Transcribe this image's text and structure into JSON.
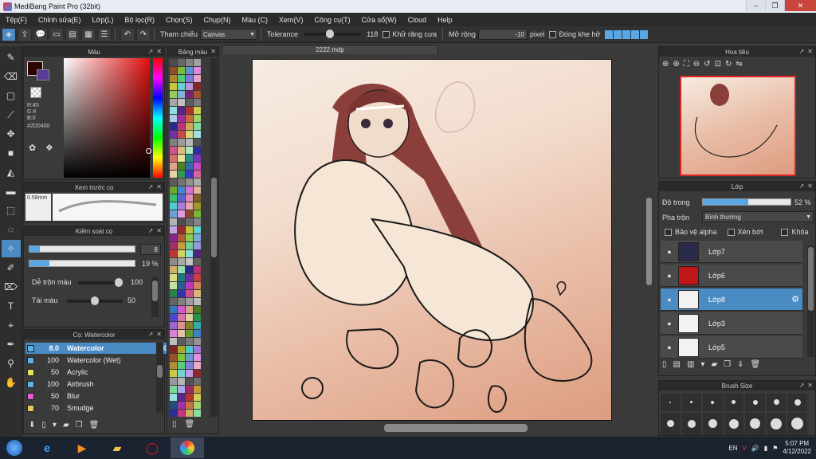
{
  "app": {
    "title": "MediBang Paint Pro (32bit)"
  },
  "menu": [
    "Tệp(F)",
    "Chỉnh sửa(E)",
    "Lớp(L)",
    "Bộ lọc(R)",
    "Chọn(S)",
    "Chụp(N)",
    "Màu (C)",
    "Xem(V)",
    "Công cụ(T)",
    "Cửa sổ(W)",
    "Cloud",
    "Help"
  ],
  "toolbar": {
    "reference_label": "Tham chiếu",
    "reference_value": "Canvas",
    "tolerance_label": "Tolerance",
    "tolerance_value": "118",
    "tolerance_fraction": 0.45,
    "antialias_label": "Khử răng cưa",
    "expand_label": "Mở rộng",
    "expand_value": "-10",
    "expand_unit": "pixel",
    "close_gap_label": "Đóng khe hở"
  },
  "color_panel": {
    "title": "Màu",
    "main_color": "#2D0400",
    "rgb_r": "R:45",
    "rgb_g": "G:4",
    "rgb_b": "B:0",
    "hex": "#2D0400"
  },
  "brush_preview": {
    "title": "Xem trước cọ",
    "size": "0.58mm"
  },
  "brush_control": {
    "title": "Kiểm soát cọ",
    "size_value": "8",
    "size_fraction": 0.1,
    "opacity_value": "19 %",
    "opacity_fraction": 0.19,
    "blend_label": "Dễ trộn màu",
    "blend_value": "100",
    "blend_fraction": 1.0,
    "load_label": "Tải màu",
    "load_value": "50",
    "load_fraction": 0.5
  },
  "brush_list": {
    "title": "Cọ: Watercolor",
    "items": [
      {
        "value": "8.0",
        "name": "Watercolor",
        "color": "#5ab4e6",
        "selected": true
      },
      {
        "value": "100",
        "name": "Watercolor (Wet)",
        "color": "#5ab4e6",
        "selected": false
      },
      {
        "value": "50",
        "name": "Acrylic",
        "color": "#e6e65a",
        "selected": false
      },
      {
        "value": "100",
        "name": "Airbrush",
        "color": "#5ab4e6",
        "selected": false
      },
      {
        "value": "50",
        "name": "Blur",
        "color": "#e65ad2",
        "selected": false
      },
      {
        "value": "70",
        "name": "Smudge",
        "color": "#e6c85a",
        "selected": false
      }
    ]
  },
  "palette_panel": {
    "title": "Bảng màu"
  },
  "document": {
    "tab": "2222.mdp"
  },
  "navigator": {
    "title": "Hoa tiêu"
  },
  "layer_panel": {
    "title": "Lớp",
    "opacity_label": "Độ trong",
    "opacity_value": "52 %",
    "opacity_fraction": 0.52,
    "blend_label": "Pha trộn",
    "blend_value": "Bình thường",
    "protect_alpha": "Bảo vệ alpha",
    "clipping": "Xén bớt",
    "lock": "Khóa",
    "layers": [
      {
        "name": "Lớp7",
        "thumb": "#2a2a4a",
        "selected": false
      },
      {
        "name": "Lớp6",
        "thumb": "#c0161a",
        "selected": false
      },
      {
        "name": "Lớp8",
        "thumb": "#f2f2f2",
        "selected": true
      },
      {
        "name": "Lớp3",
        "thumb": "#f2f2f2",
        "selected": false
      },
      {
        "name": "Lớp5",
        "thumb": "#f2f2f2",
        "selected": false
      }
    ]
  },
  "brush_size_panel": {
    "title": "Brush Size"
  },
  "taskbar": {
    "lang": "EN",
    "time": "5:07 PM",
    "date": "4/12/2022"
  }
}
